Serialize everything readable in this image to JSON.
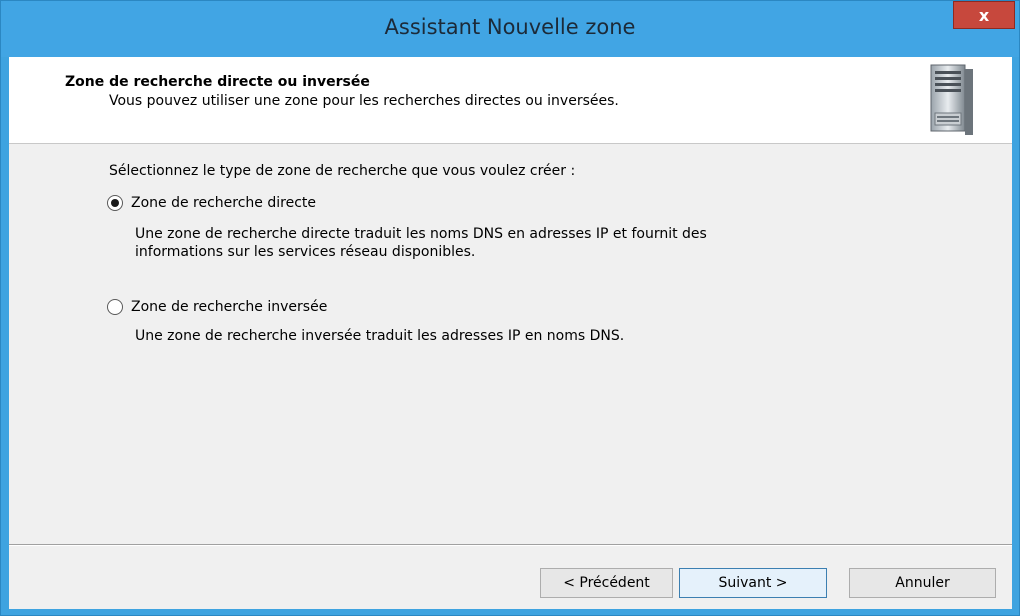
{
  "window": {
    "title": "Assistant Nouvelle zone",
    "close_label": "x"
  },
  "header": {
    "title": "Zone de recherche directe ou inversée",
    "subtitle": "Vous pouvez utiliser une zone pour les recherches directes ou inversées.",
    "icon": "server-icon"
  },
  "body": {
    "prompt": "Sélectionnez le type de zone de recherche que vous voulez créer :",
    "options": [
      {
        "label": "Zone de recherche directe",
        "selected": true,
        "description_line1": "Une zone de recherche directe traduit les noms DNS en adresses IP et fournit des",
        "description_line2": "informations sur les services réseau disponibles."
      },
      {
        "label": "Zone de recherche inversée",
        "selected": false,
        "description_line1": "Une zone de recherche inversée traduit les adresses IP en noms DNS."
      }
    ]
  },
  "buttons": {
    "previous": "< Précédent",
    "next": "Suivant >",
    "cancel": "Annuler"
  },
  "colors": {
    "titlebar": "#41a5e4",
    "close": "#c7483d",
    "client_bg": "#f0f0f0"
  }
}
